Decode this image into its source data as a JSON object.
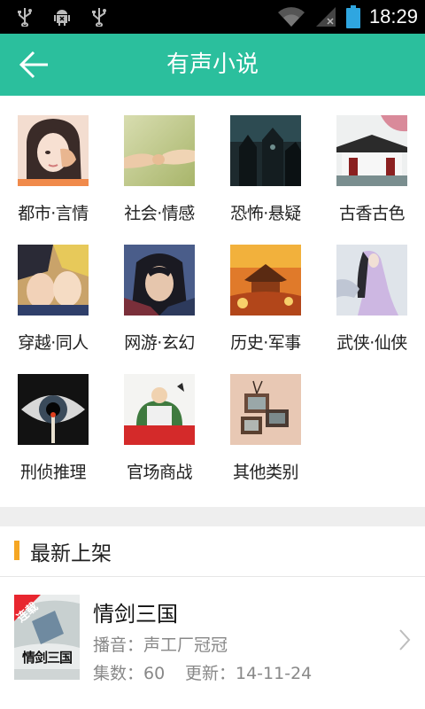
{
  "status_bar": {
    "time": "18:29",
    "icons": [
      "usb-icon",
      "android-debug-icon",
      "usb-icon",
      "wifi-icon",
      "signal-icon",
      "battery-icon"
    ]
  },
  "toolbar": {
    "title": "有声小说",
    "back_icon": "back-arrow-icon"
  },
  "categories": [
    {
      "label": "都市·言情"
    },
    {
      "label": "社会·情感"
    },
    {
      "label": "恐怖·悬疑"
    },
    {
      "label": "古香古色"
    },
    {
      "label": "穿越·同人"
    },
    {
      "label": "网游·玄幻"
    },
    {
      "label": "历史·军事"
    },
    {
      "label": "武侠·仙侠"
    },
    {
      "label": "刑侦推理"
    },
    {
      "label": "官场商战"
    },
    {
      "label": "其他类别"
    }
  ],
  "latest": {
    "section_title": "最新上架",
    "books": [
      {
        "title": "情剑三国",
        "narrator": "播音：声工厂冠冠",
        "episodes": "集数：60",
        "updated": "更新：14-11-24",
        "badge": "连载",
        "cover_text": "情剑三国"
      }
    ]
  },
  "colors": {
    "accent": "#2bbf9d",
    "section_marker": "#f5a623",
    "badge": "#e8262f"
  }
}
